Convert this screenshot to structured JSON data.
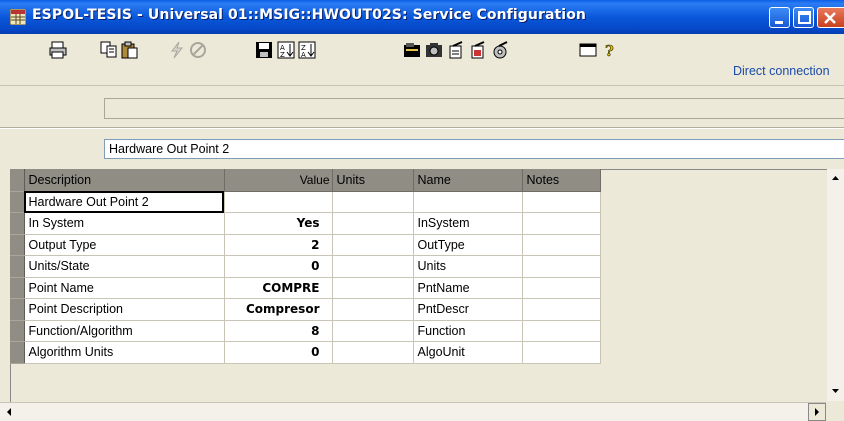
{
  "window": {
    "title": "ESPOL-TESIS - Universal 01::MSIG::HWOUT02S: Service Configuration",
    "app_icon": "grid-app-icon",
    "buttons": [
      "minimize-icon",
      "maximize-icon",
      "close-icon"
    ]
  },
  "toolbar": {
    "icons": [
      "print-icon",
      "copy-icon",
      "paste-icon",
      "lightning-icon",
      "no-icon",
      "save-icon",
      "sort-asc-icon",
      "sort-desc-icon",
      "folder-icon",
      "camera-icon",
      "doc-arrow-icon",
      "doc-arrow2-icon",
      "disk-arrow-icon",
      "window-icon",
      "help-icon"
    ],
    "connection_status": "Direct connection"
  },
  "address": {
    "value": ""
  },
  "point_name": "Hardware Out Point 2",
  "grid": {
    "columns": [
      "Description",
      "Value",
      "Units",
      "Name",
      "Notes"
    ],
    "rows": [
      {
        "description": "Hardware Out Point 2",
        "value": "",
        "units": "",
        "name": "",
        "notes": ""
      },
      {
        "description": "In System",
        "value": "Yes",
        "units": "",
        "name": "InSystem",
        "notes": ""
      },
      {
        "description": "Output Type",
        "value": "2",
        "units": "",
        "name": "OutType",
        "notes": ""
      },
      {
        "description": "Units/State",
        "value": "0",
        "units": "",
        "name": "Units",
        "notes": ""
      },
      {
        "description": "Point Name",
        "value": "COMPRE",
        "units": "",
        "name": "PntName",
        "notes": ""
      },
      {
        "description": "Point Description",
        "value": "Compresor",
        "units": "",
        "name": "PntDescr",
        "notes": ""
      },
      {
        "description": "Function/Algorithm",
        "value": "8",
        "units": "",
        "name": "Function",
        "notes": ""
      },
      {
        "description": "Algorithm Units",
        "value": "0",
        "units": "",
        "name": "AlgoUnit",
        "notes": ""
      }
    ]
  },
  "colors": {
    "titlebar": "#0b58db",
    "header": "#8f8d84",
    "background": "#ece9d8",
    "link": "#1a4aa8"
  }
}
